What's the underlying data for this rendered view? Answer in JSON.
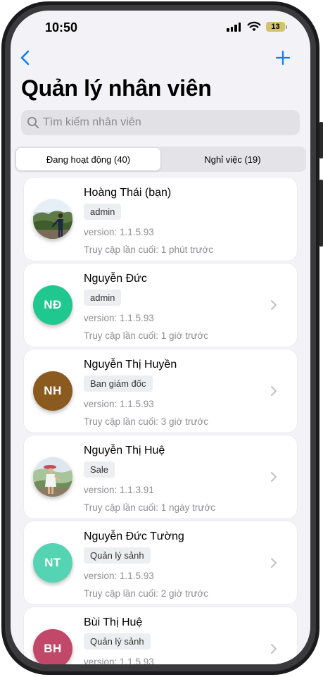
{
  "status_bar": {
    "time": "10:50",
    "battery": "13"
  },
  "nav": {
    "title": "Quản lý nhân viên"
  },
  "search": {
    "placeholder": "Tìm kiếm nhân viên"
  },
  "tabs": [
    {
      "label": "Đang hoạt động (40)",
      "active": true
    },
    {
      "label": "Nghỉ việc (19)",
      "active": false
    }
  ],
  "employees": [
    {
      "name": "Hoàng Thái (bạn)",
      "role": "admin",
      "version": "version: 1.1.5.93",
      "last_access": "Truy cập lần cuối: 1 phút trước",
      "initials": "",
      "avatar_color": "#7f9bb3",
      "photo": true,
      "chevron": false
    },
    {
      "name": "Nguyễn Đức",
      "role": "admin",
      "version": "version: 1.1.5.93",
      "last_access": "Truy cập lần cuối: 1 giờ trước",
      "initials": "NĐ",
      "avatar_color": "#1fc88f",
      "photo": false,
      "chevron": true
    },
    {
      "name": "Nguyễn Thị Huyền",
      "role": "Ban giám đốc",
      "version": "version: 1.1.5.93",
      "last_access": "Truy cập lần cuối: 3 giờ trước",
      "initials": "NH",
      "avatar_color": "#8a5a1f",
      "photo": false,
      "chevron": true
    },
    {
      "name": "Nguyễn Thị Huệ",
      "role": "Sale",
      "version": "version: 1.1.3.91",
      "last_access": "Truy cập lần cuối: 1 ngày trước",
      "initials": "",
      "avatar_color": "#a7c49a",
      "photo": true,
      "chevron": true
    },
    {
      "name": "Nguyễn Đức Tường",
      "role": "Quản lý sảnh",
      "version": "version: 1.1.5.93",
      "last_access": "Truy cập lần cuối: 2 giờ trước",
      "initials": "NT",
      "avatar_color": "#55d4b4",
      "photo": false,
      "chevron": true
    },
    {
      "name": "Bùi Thị Huệ",
      "role": "Quản lý sảnh",
      "version": "version: 1.1.5.93",
      "last_access": "",
      "initials": "BH",
      "avatar_color": "#c2486a",
      "photo": false,
      "chevron": true
    }
  ],
  "colors": {
    "accent": "#0a7ff5",
    "background": "#f2f2f7",
    "card": "#ffffff",
    "muted_text": "#8e8e93"
  },
  "icons": {
    "back": "chevron-left-icon",
    "add": "plus-icon",
    "search": "magnifier-icon",
    "row_chevron": "chevron-right-icon"
  }
}
